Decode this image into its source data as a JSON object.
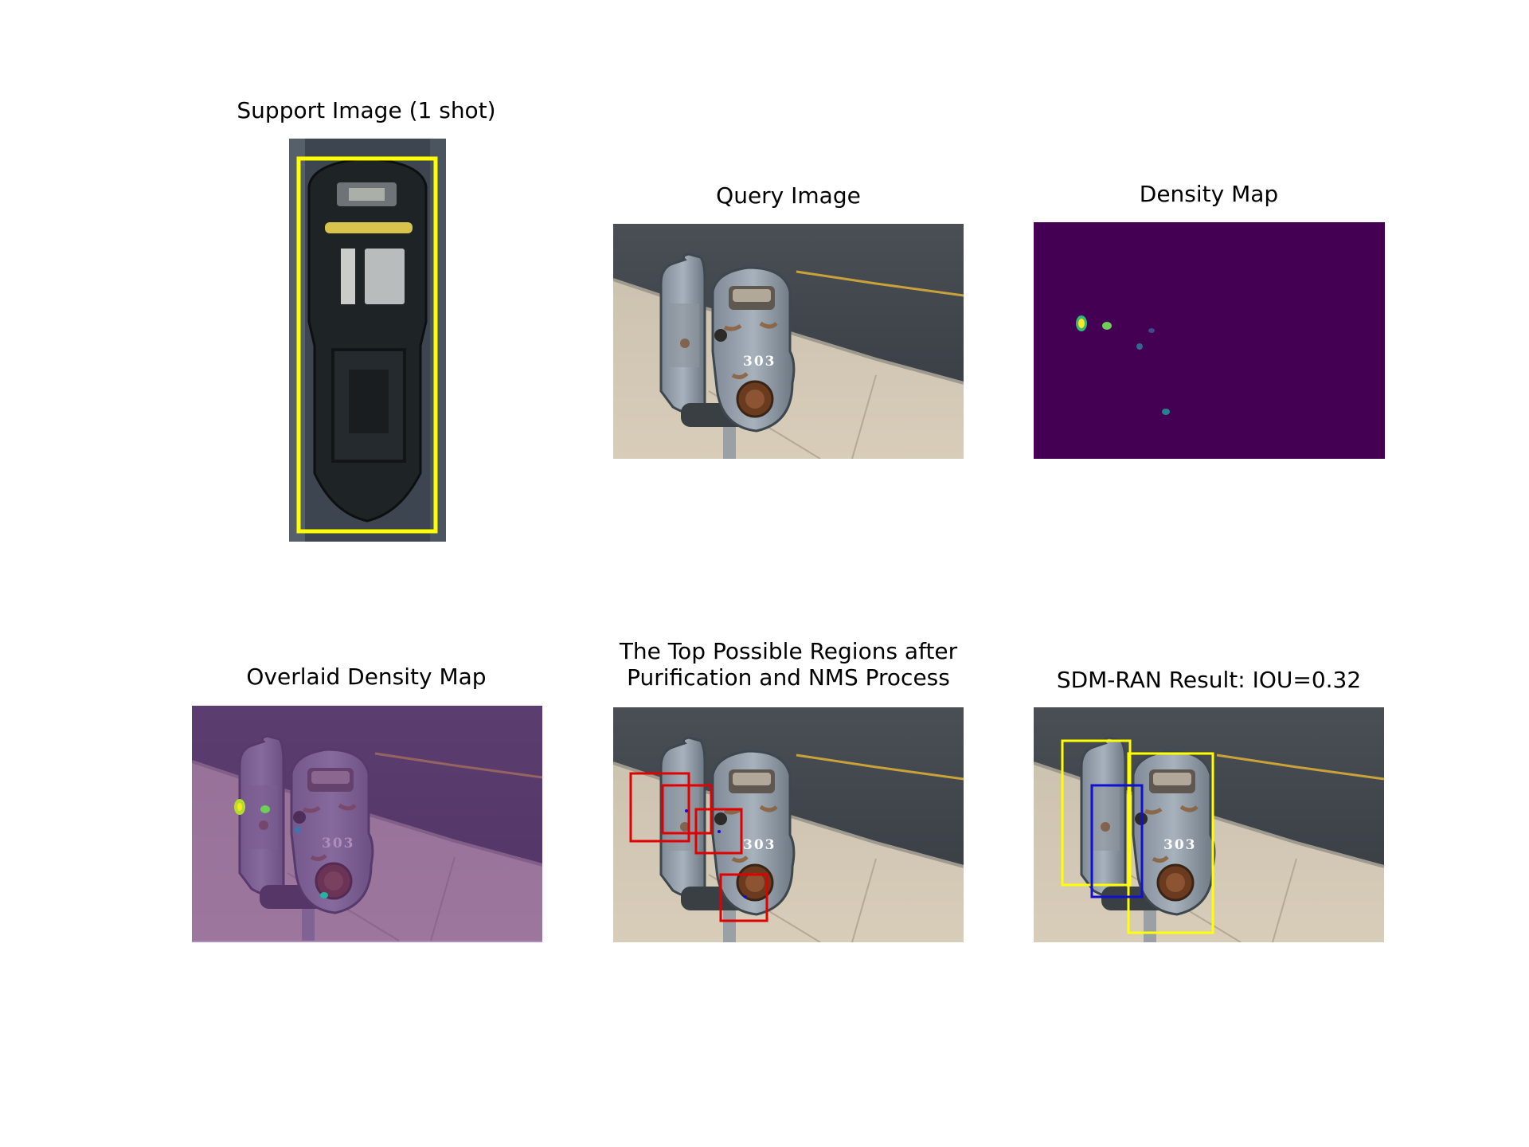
{
  "panels": {
    "support": {
      "title": "Support Image (1 shot)"
    },
    "query": {
      "title": "Query Image",
      "meter_number": "303"
    },
    "density": {
      "title": "Density Map"
    },
    "overlaid": {
      "title": "Overlaid Density Map"
    },
    "regions": {
      "title_line1": "The Top Possible Regions after",
      "title_line2": "Purification and NMS Process"
    },
    "result": {
      "title": "SDM-RAN Result: IOU=0.32"
    }
  },
  "colors": {
    "exemplar_box": "#ffff00",
    "region_box": "#e00000",
    "prediction_box": "#1010d0",
    "density_background": "#440154",
    "overlay_tint": "#8a4fa0"
  }
}
